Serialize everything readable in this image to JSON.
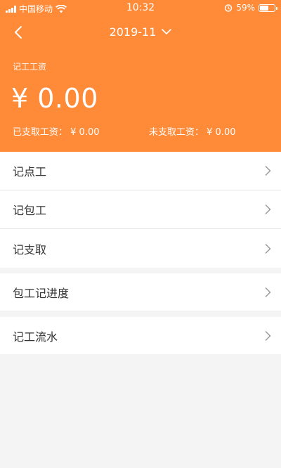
{
  "status": {
    "carrier": "中国移动",
    "time": "10:32",
    "battery": "59%",
    "battery_level": 0.59
  },
  "header": {
    "month": "2019-11",
    "wage_label": "记工工资",
    "wage_amount": "¥ 0.00",
    "paid_label": "已支取工资：",
    "paid_value": "¥ 0.00",
    "unpaid_label": "未支取工资：",
    "unpaid_value": "¥ 0.00",
    "accent_color": "#ff8a38"
  },
  "menu": {
    "group1": [
      {
        "label": "记点工"
      },
      {
        "label": "记包工"
      },
      {
        "label": "记支取"
      }
    ],
    "group2": [
      {
        "label": "包工记进度"
      }
    ],
    "group3": [
      {
        "label": "记工流水"
      }
    ]
  },
  "icons": {
    "back": "chevron-left-icon",
    "dropdown": "chevron-down-icon",
    "row_arrow": "chevron-right-icon"
  }
}
